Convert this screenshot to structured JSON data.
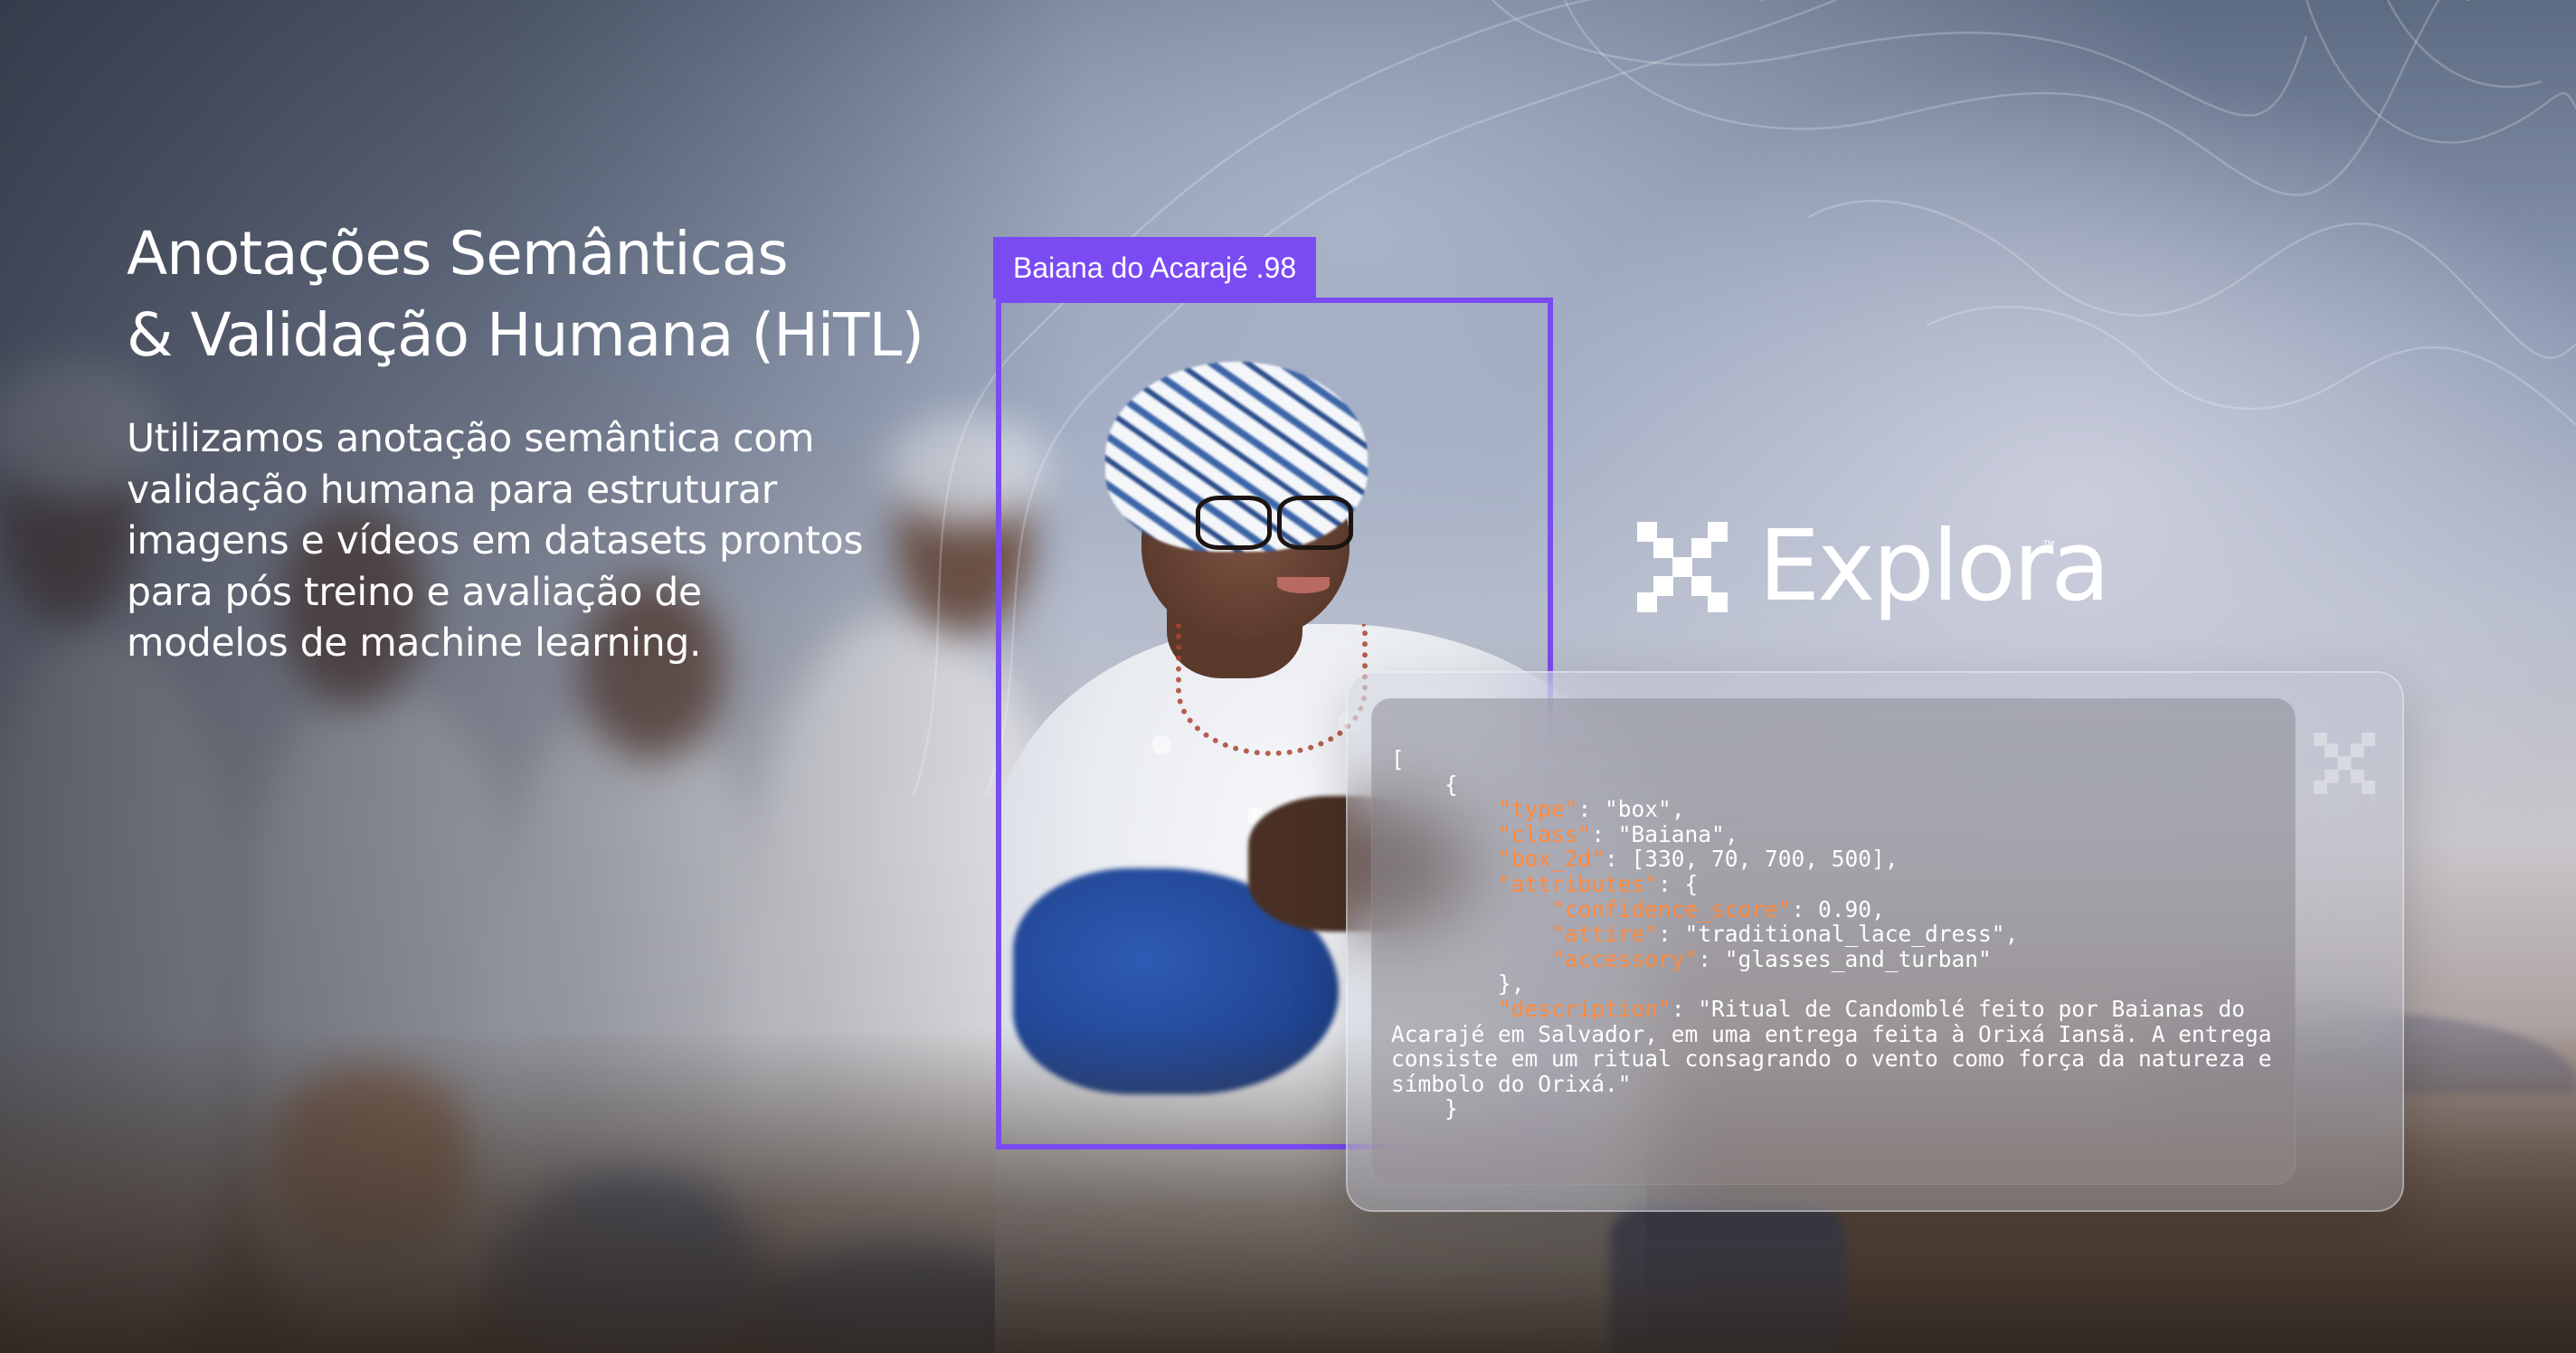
{
  "headline": {
    "line1": "Anotações Semânticas",
    "line2": "& Validação Humana (HiTL)"
  },
  "lede": {
    "lines": [
      "Utilizamos anotação semântica com",
      "validação humana para estruturar",
      "imagens e vídeos em datasets prontos",
      "para pós treino e avaliação de",
      "modelos de machine learning."
    ]
  },
  "detection": {
    "label": "Baiana do Acarajé .98",
    "box_color": "#7a4bf2"
  },
  "logo": {
    "text": "Explora",
    "trademark": "™",
    "icon": "explora-mark-icon"
  },
  "code": {
    "open_bracket": "[",
    "open_brace": "{",
    "type_key": "\"type\"",
    "type_val": "\"box\"",
    "class_key": "\"class\"",
    "class_val": "\"Baiana\"",
    "box_key": "\"box_2d\"",
    "box_val": "[330, 70, 700, 500]",
    "attr_key": "\"attributes\"",
    "conf_key": "\"confidence_score\"",
    "conf_val": "0.90",
    "attire_key": "\"attire\"",
    "attire_val": "\"traditional_lace_dress\"",
    "acc_key": "\"accessory\"",
    "acc_val": "\"glasses_and_turban\"",
    "attr_close": "},",
    "desc_key": "\"description\"",
    "desc_line1": "\"Ritual de Candomblé feito por Baianas do",
    "desc_line2": "Acarajé em Salvador, em uma entrega feita à Orixá Iansã. A entrega",
    "desc_line3": "consiste em um ritual consagrando o vento como força da natureza e",
    "desc_line4": "símbolo do Orixá.\"",
    "close_brace": "}",
    "key_color": "#ff8a3d"
  }
}
